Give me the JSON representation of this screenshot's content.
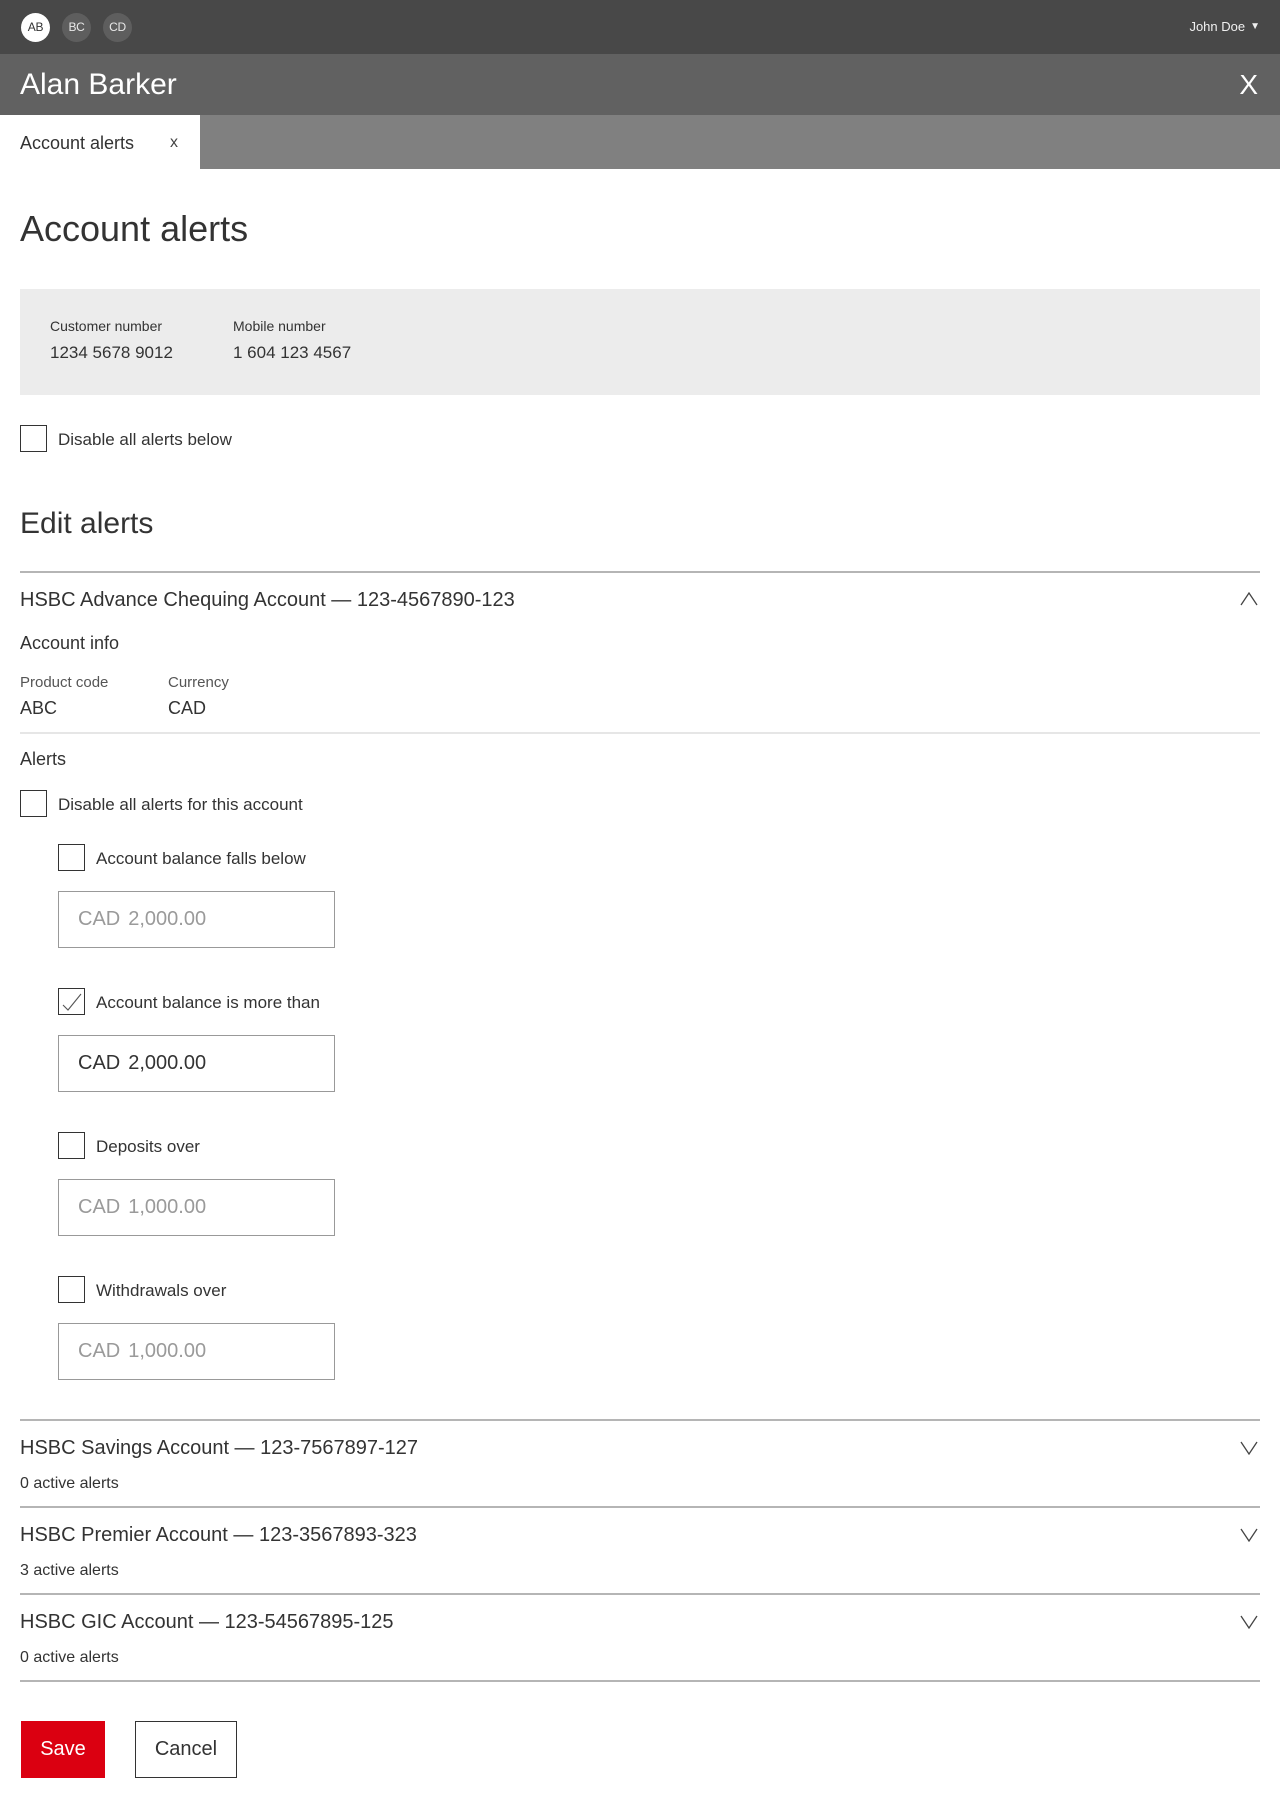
{
  "topbar": {
    "avatars": [
      {
        "initials": "AB",
        "active": true
      },
      {
        "initials": "BC",
        "active": false
      },
      {
        "initials": "CD",
        "active": false
      }
    ],
    "user_name": "John Doe",
    "user_caret": "▼"
  },
  "titlebar": {
    "customer_name": "Alan Barker",
    "close_label": "X"
  },
  "tabs": [
    {
      "label": "Account alerts",
      "close_label": "x"
    }
  ],
  "page": {
    "title": "Account alerts",
    "customer_number_label": "Customer number",
    "customer_number": "1234 5678 9012",
    "mobile_number_label": "Mobile number",
    "mobile_number": "1 604 123 4567",
    "disable_all_label": "Disable all alerts below",
    "disable_all_checked": false,
    "edit_alerts_title": "Edit alerts"
  },
  "accounts": [
    {
      "title": "HSBC Advance Chequing Account — 123-4567890-123",
      "expanded": true,
      "account_info_title": "Account info",
      "product_code_label": "Product code",
      "product_code": "ABC",
      "currency_label": "Currency",
      "currency": "CAD",
      "alerts_title": "Alerts",
      "disable_account_label": "Disable all alerts for this account",
      "disable_account_checked": false,
      "alerts": [
        {
          "label": "Account balance falls below",
          "checked": false,
          "currency": "CAD",
          "amount": "2,000.00"
        },
        {
          "label": "Account balance is more than",
          "checked": true,
          "currency": "CAD",
          "amount": "2,000.00"
        },
        {
          "label": "Deposits over",
          "checked": false,
          "currency": "CAD",
          "amount": "1,000.00"
        },
        {
          "label": "Withdrawals over",
          "checked": false,
          "currency": "CAD",
          "amount": "1,000.00"
        }
      ]
    },
    {
      "title": "HSBC Savings Account — 123-7567897-127",
      "expanded": false,
      "active_alerts": "0 active alerts"
    },
    {
      "title": "HSBC Premier Account — 123-3567893-323",
      "expanded": false,
      "active_alerts": "3 active alerts"
    },
    {
      "title": "HSBC GIC Account — 123-54567895-125",
      "expanded": false,
      "active_alerts": "0 active alerts"
    }
  ],
  "actions": {
    "save_label": "Save",
    "cancel_label": "Cancel"
  },
  "colors": {
    "primary_red": "#db0011",
    "topbar": "#484848",
    "titlebar": "#616161",
    "tabbar": "#808080",
    "info_box": "#ececec"
  }
}
